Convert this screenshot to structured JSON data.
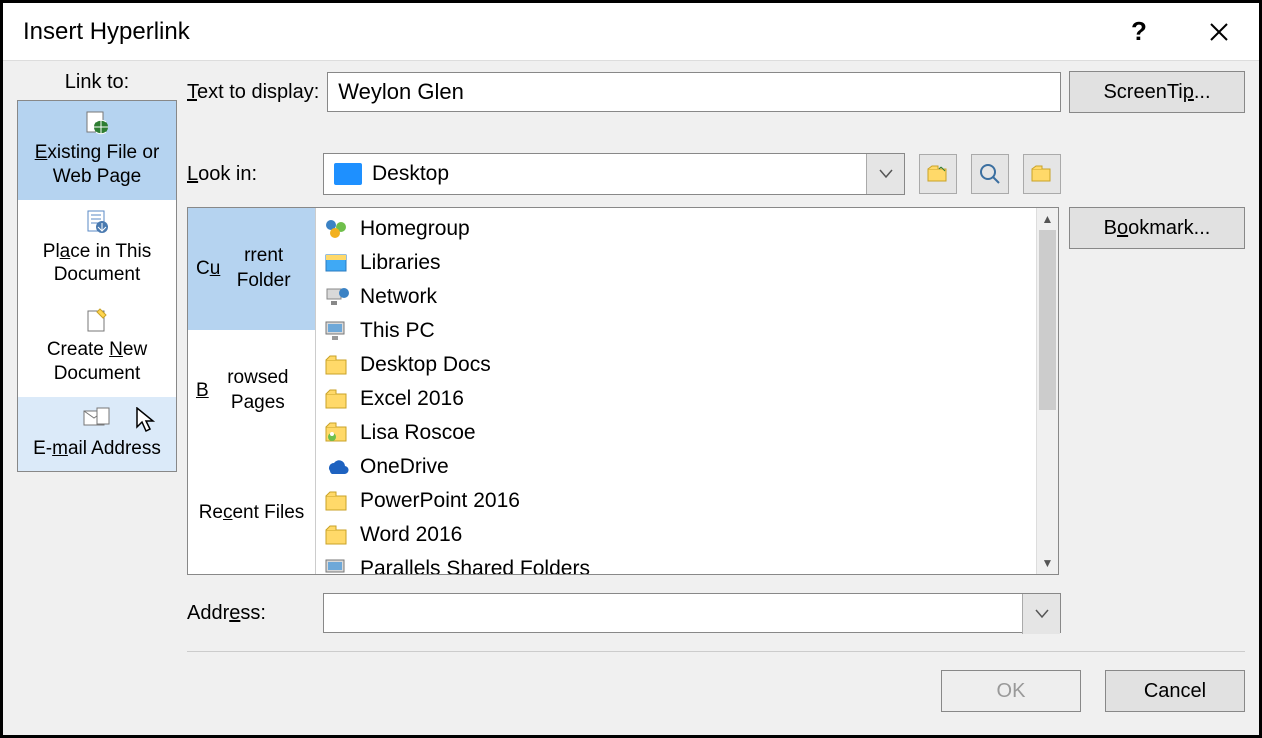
{
  "title": "Insert Hyperlink",
  "linkto": {
    "label": "Link to:",
    "items": [
      {
        "label": "Existing File or Web Page",
        "icon": "file-web"
      },
      {
        "label": "Place in This Document",
        "icon": "doc-place"
      },
      {
        "label": "Create New Document",
        "icon": "doc-new"
      },
      {
        "label": "E-mail Address",
        "icon": "email"
      }
    ]
  },
  "text_to_display": {
    "label": "Text to display:",
    "value": "Weylon Glen"
  },
  "screentip_label": "ScreenTip...",
  "lookin": {
    "label": "Look in:",
    "value": "Desktop"
  },
  "browse_tabs": {
    "current": "Current Folder",
    "browsed": "Browsed Pages",
    "recent": "Recent Files"
  },
  "file_list": [
    {
      "name": "Homegroup",
      "icon": "homegroup"
    },
    {
      "name": "Libraries",
      "icon": "libraries"
    },
    {
      "name": "Network",
      "icon": "network"
    },
    {
      "name": "This PC",
      "icon": "pc"
    },
    {
      "name": "Desktop Docs",
      "icon": "folder"
    },
    {
      "name": "Excel 2016",
      "icon": "folder"
    },
    {
      "name": "Lisa Roscoe",
      "icon": "user-folder"
    },
    {
      "name": "OneDrive",
      "icon": "onedrive"
    },
    {
      "name": "PowerPoint 2016",
      "icon": "folder"
    },
    {
      "name": "Word 2016",
      "icon": "folder"
    },
    {
      "name": "Parallels Shared Folders",
      "icon": "pc"
    }
  ],
  "bookmark_label": "Bookmark...",
  "address": {
    "label": "Address:",
    "value": ""
  },
  "buttons": {
    "ok": "OK",
    "cancel": "Cancel"
  }
}
